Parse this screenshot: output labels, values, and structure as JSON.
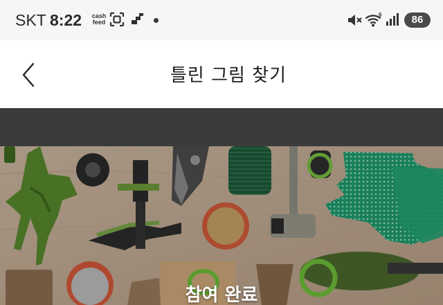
{
  "status_bar": {
    "carrier": "SKT",
    "time": "8:22",
    "notification_app": "cash feed",
    "notification_app_lines": [
      "cash",
      "feed"
    ],
    "icons": [
      "cashfeed-icon",
      "scan-icon",
      "app-icon",
      "dot-icon",
      "mute-icon",
      "wifi-icon",
      "signal-icon"
    ],
    "battery": "86"
  },
  "header": {
    "title": "틀린 그림 찾기",
    "back_icon": "chevron-left-icon"
  },
  "puzzle": {
    "image": "garden-tools-photo",
    "status_label": "참여 완료"
  }
}
